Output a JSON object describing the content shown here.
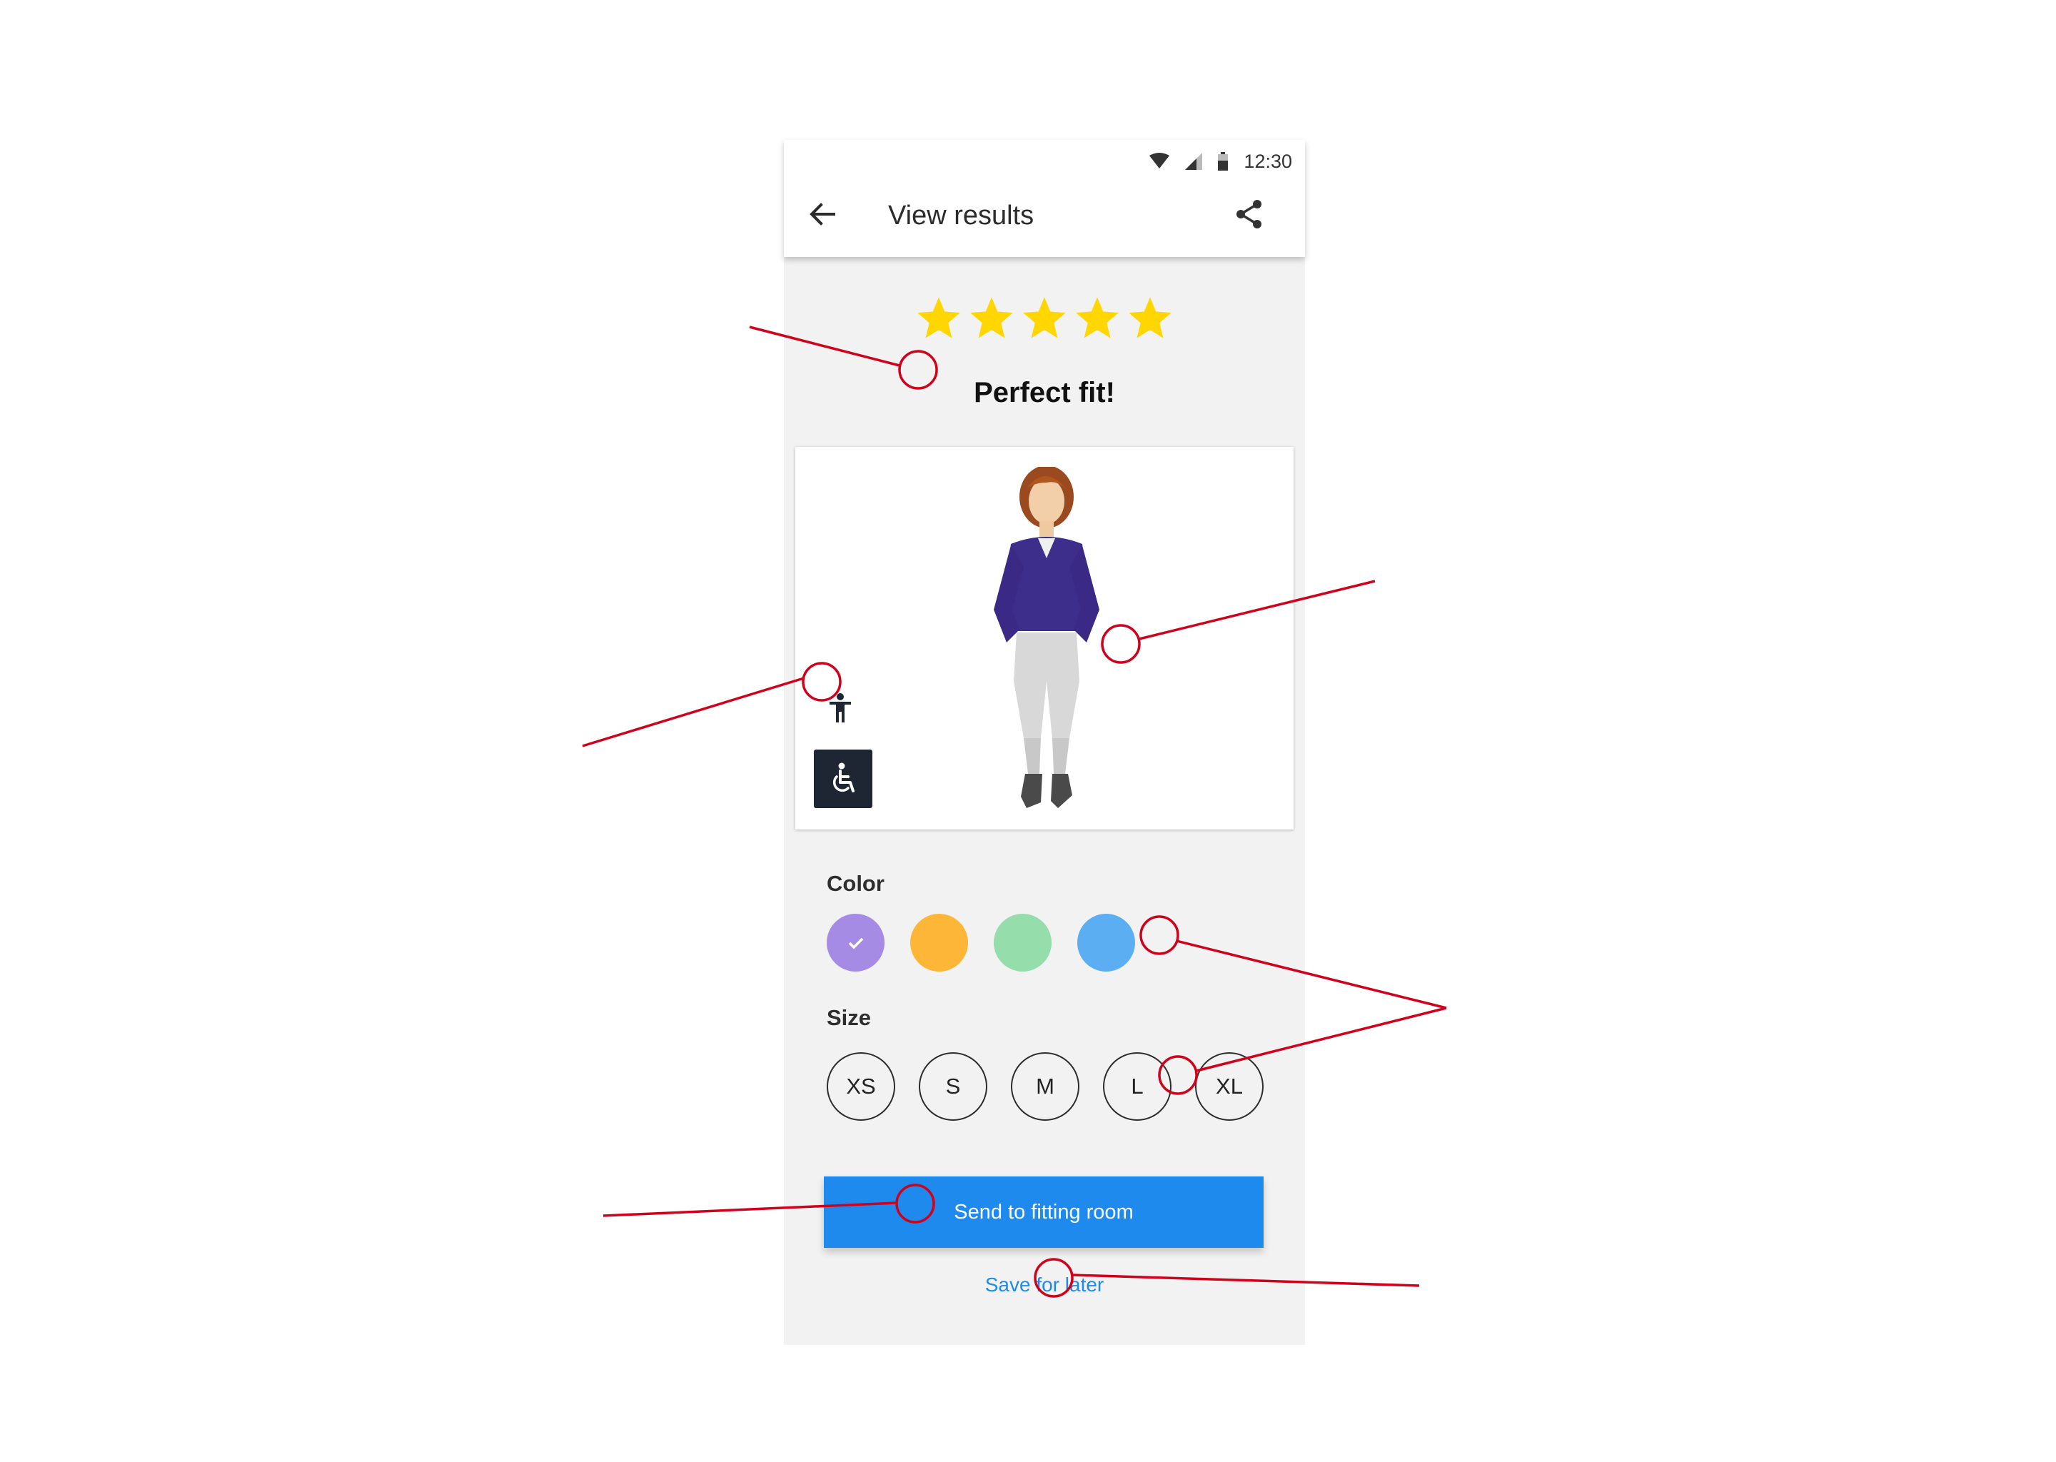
{
  "status_bar": {
    "time": "12:30",
    "icons": [
      "wifi-icon",
      "signal-icon",
      "battery-icon"
    ]
  },
  "app_bar": {
    "title": "View results",
    "back_icon": "arrow-left-icon",
    "share_icon": "share-icon"
  },
  "rating": {
    "stars": 5,
    "max": 5,
    "star_color": "#FFD600",
    "message": "Perfect fit!"
  },
  "preview": {
    "pose_icon": "standing-figure-icon",
    "seated_icon": "wheelchair-icon"
  },
  "color": {
    "label": "Color",
    "options": [
      {
        "name": "purple",
        "hex": "#A58BE4",
        "selected": true
      },
      {
        "name": "orange",
        "hex": "#FDB638",
        "selected": false
      },
      {
        "name": "green",
        "hex": "#95DDAA",
        "selected": false
      },
      {
        "name": "blue",
        "hex": "#5AAEF1",
        "selected": false
      }
    ]
  },
  "size": {
    "label": "Size",
    "options": [
      "XS",
      "S",
      "M",
      "L",
      "XL"
    ]
  },
  "actions": {
    "primary": "Send to fitting room",
    "secondary": "Save for later"
  },
  "colors": {
    "accent": "#1F8AEE",
    "callout": "#D0021B",
    "background": "#F2F2F2"
  }
}
